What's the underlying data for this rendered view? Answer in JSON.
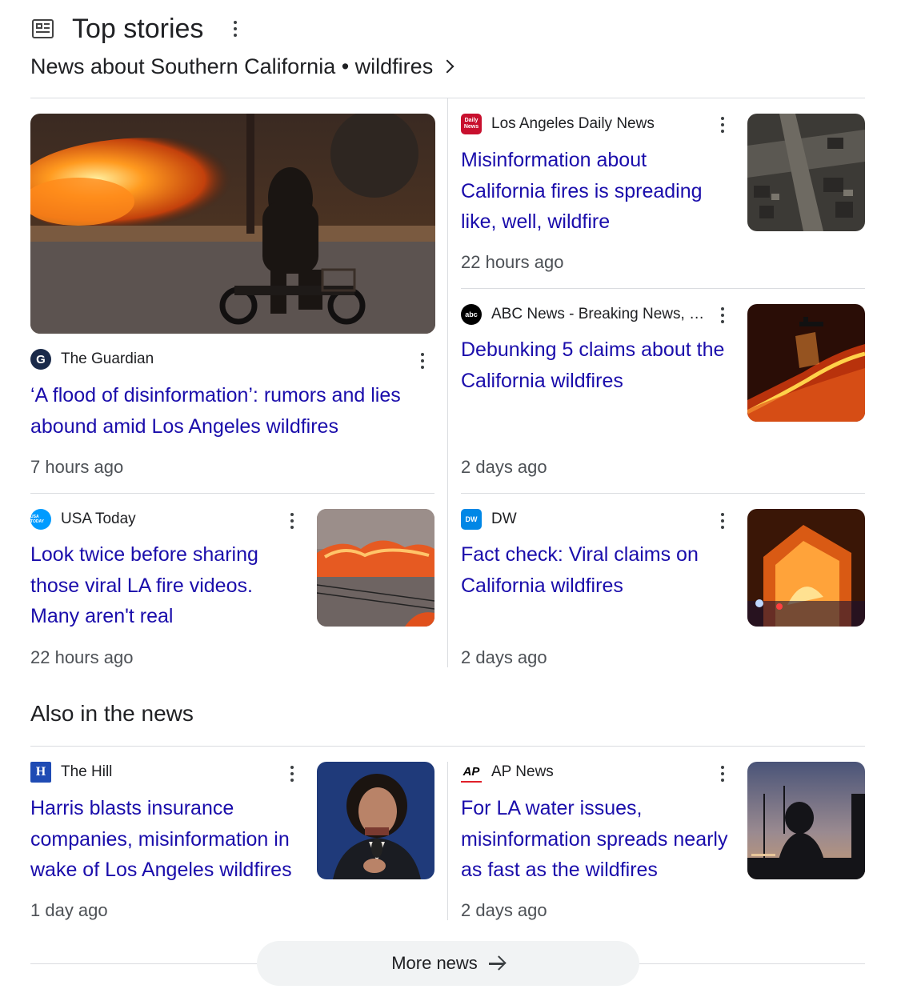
{
  "header": {
    "title": "Top stories",
    "icon": "newspaper-icon"
  },
  "subtitle": {
    "text": "News about Southern California • wildfires"
  },
  "stories": [
    {
      "source": "The Guardian",
      "logo_text": "G",
      "logo_color": "#1a2a4a",
      "headline": "‘A flood of disinformation’: rumors and lies abound amid Los Angeles wildfires",
      "time": "7 hours ago"
    },
    {
      "source": "Los Angeles Daily News",
      "logo_text": "Daily News",
      "logo_color": "#c8102e",
      "headline": "Misinformation about California fires is spreading like, well, wildfire",
      "time": "22 hours ago"
    },
    {
      "source": "ABC News - Breaking News, …",
      "logo_text": "abc",
      "logo_color": "#000000",
      "headline": "Debunking 5 claims about the California wildfires",
      "time": "2 days ago"
    },
    {
      "source": "USA Today",
      "logo_text": "USA TODAY",
      "logo_color": "#009bff",
      "headline": "Look twice before sharing those viral LA fire videos. Many aren't real",
      "time": "22 hours ago"
    },
    {
      "source": "DW",
      "logo_text": "DW",
      "logo_color": "#0087e6",
      "headline": "Fact check: Viral claims on California wildfires",
      "time": "2 days ago"
    }
  ],
  "also": {
    "title": "Also in the news",
    "stories": [
      {
        "source": "The Hill",
        "logo_text": "H",
        "logo_color": "#1f4bb4",
        "headline": "Harris blasts insurance companies, misinformation in wake of Los Angeles wildfires",
        "time": "1 day ago"
      },
      {
        "source": "AP News",
        "logo_text": "AP",
        "logo_color": "#ffffff",
        "headline": "For LA water issues, misinformation spreads nearly as fast as the wildfires",
        "time": "2 days ago"
      }
    ]
  },
  "more_button": {
    "label": "More news"
  },
  "colors": {
    "link": "#1a0dab",
    "meta": "#4d5156",
    "divider": "#dadce0"
  }
}
